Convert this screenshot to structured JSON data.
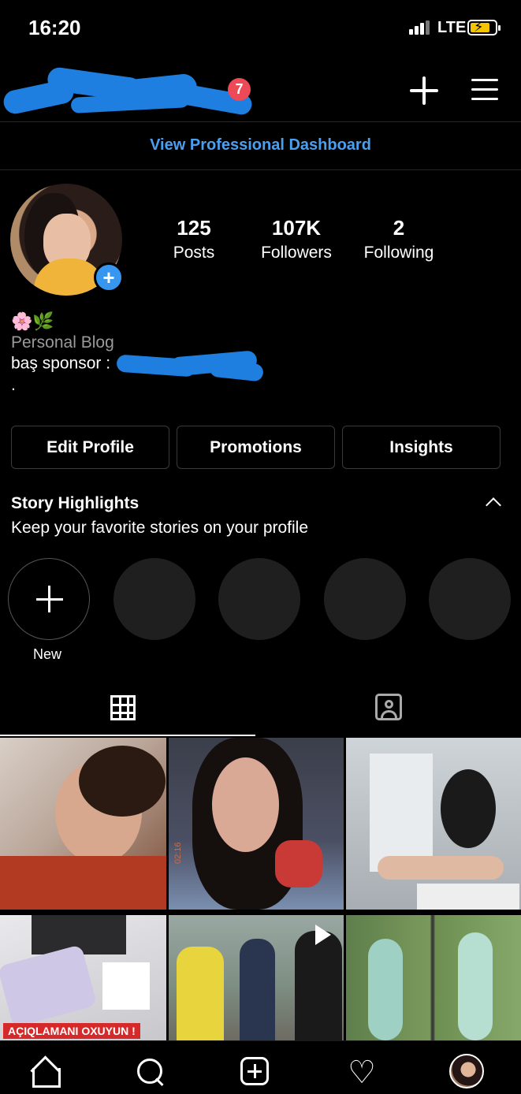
{
  "status_bar": {
    "time": "16:20",
    "network": "LTE",
    "icons": [
      "signal-icon",
      "battery-charging-icon"
    ]
  },
  "header": {
    "notification_count": "7",
    "icons": [
      "new-post-icon",
      "menu-icon"
    ]
  },
  "dashboard": {
    "label": "View Professional Dashboard"
  },
  "profile": {
    "stats": [
      {
        "value": "125",
        "label": "Posts"
      },
      {
        "value": "107K",
        "label": "Followers"
      },
      {
        "value": "2",
        "label": "Following"
      }
    ],
    "bio_emojis": "🌸🌿",
    "category": "Personal Blog",
    "bio_line": "baş sponsor :",
    "bio_dot": "."
  },
  "actions": {
    "edit_profile": "Edit Profile",
    "promotions": "Promotions",
    "insights": "Insights"
  },
  "highlights": {
    "title": "Story Highlights",
    "subtitle": "Keep your favorite stories on your profile",
    "new_label": "New"
  },
  "posts": {
    "banner_text": "AÇIQLAMANI OXUYUN !",
    "stamp_text": "02:16"
  },
  "bottom_nav": {
    "icons": [
      "home-icon",
      "search-icon",
      "create-icon",
      "heart-icon",
      "profile-icon"
    ]
  },
  "colors": {
    "accent_blue": "#4a9fee",
    "badge_red": "#ed4956",
    "button_border": "#3a3a3a"
  }
}
